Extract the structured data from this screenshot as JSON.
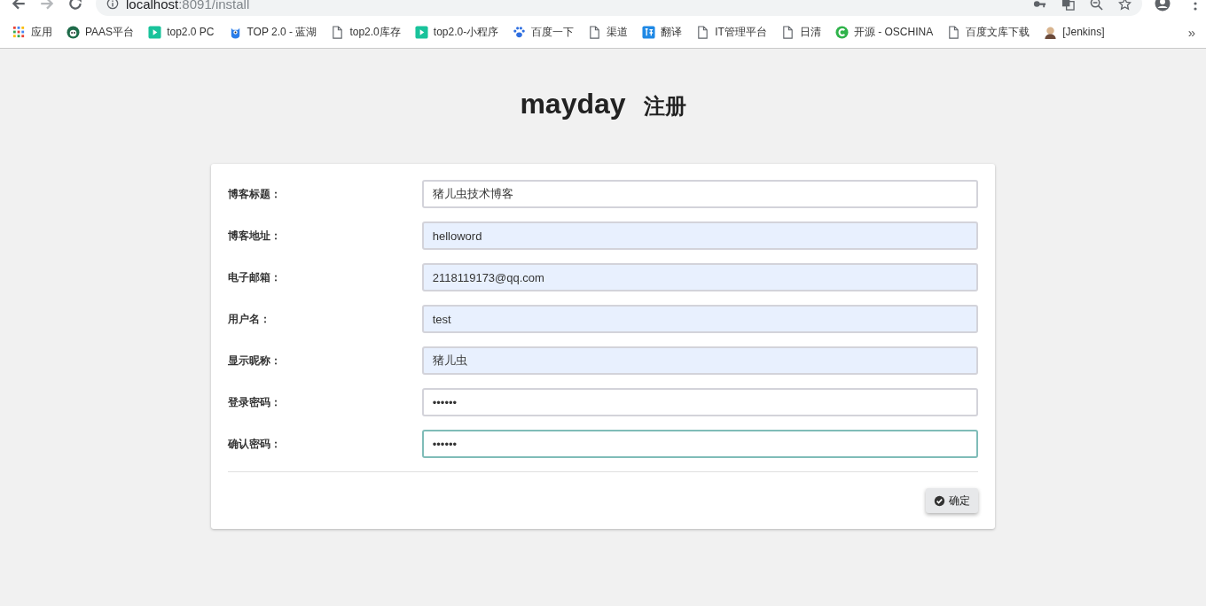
{
  "browser": {
    "address": {
      "host": "localhost",
      "path": ":8091/install"
    },
    "bookmarks": [
      {
        "label": "应用",
        "kind": "apps"
      },
      {
        "label": "PAAS平台",
        "kind": "round"
      },
      {
        "label": "top2.0 PC",
        "kind": "play"
      },
      {
        "label": "TOP 2.0 - 蓝湖",
        "kind": "mascot"
      },
      {
        "label": "top2.0库存",
        "kind": "page"
      },
      {
        "label": "top2.0-小程序",
        "kind": "play"
      },
      {
        "label": "百度一下",
        "kind": "paw"
      },
      {
        "label": "渠道",
        "kind": "page"
      },
      {
        "label": "翻译",
        "kind": "translate"
      },
      {
        "label": "IT管理平台",
        "kind": "page"
      },
      {
        "label": "日清",
        "kind": "page"
      },
      {
        "label": "开源 - OSCHINA",
        "kind": "c"
      },
      {
        "label": "百度文库下载",
        "kind": "page"
      },
      {
        "label": "[Jenkins]",
        "kind": "person"
      }
    ],
    "more": "»"
  },
  "heading": {
    "brand": "mayday",
    "title": "注册"
  },
  "fields": [
    {
      "label": "博客标题：",
      "value": "猪儿虫技术博客",
      "autofilled": false,
      "focused": false
    },
    {
      "label": "博客地址：",
      "value": "helloword",
      "autofilled": true,
      "focused": false
    },
    {
      "label": "电子邮箱：",
      "value": "2118119173@qq.com",
      "autofilled": true,
      "focused": false
    },
    {
      "label": "用户名：",
      "value": "test",
      "autofilled": true,
      "focused": false
    },
    {
      "label": "显示昵称：",
      "value": "猪儿虫",
      "autofilled": true,
      "focused": false
    },
    {
      "label": "登录密码：",
      "value": "••••••",
      "autofilled": false,
      "focused": false
    },
    {
      "label": "确认密码：",
      "value": "••••••",
      "autofilled": false,
      "focused": true
    }
  ],
  "submit": {
    "label": "确定"
  }
}
